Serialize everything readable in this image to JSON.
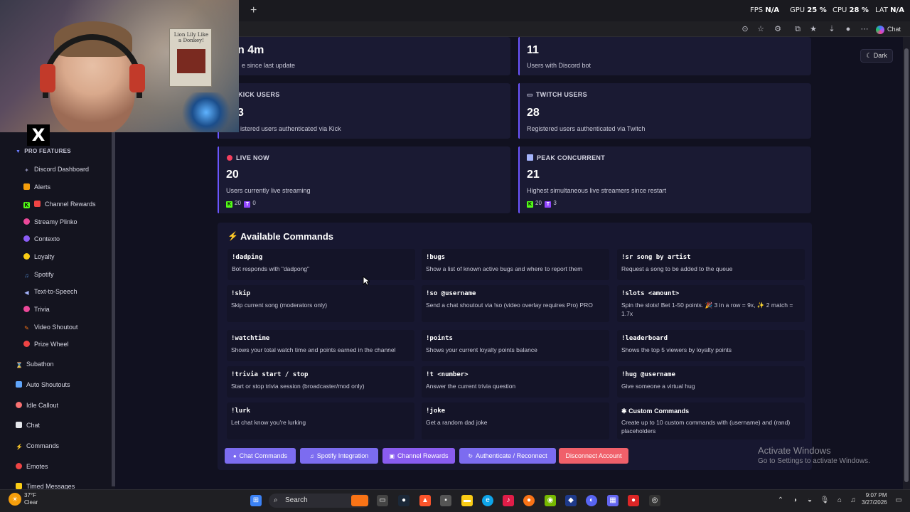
{
  "browser": {
    "new_tab_symbol": "+",
    "chat_label": "Chat",
    "perf": {
      "fps_label": "FPS",
      "fps_value": "N/A",
      "gpu_label": "GPU",
      "gpu_value": "25 %",
      "cpu_label": "CPU",
      "cpu_value": "28 %",
      "lat_label": "LAT",
      "lat_value": "N/A"
    }
  },
  "webcam": {
    "poster_text": "Lion Lily Like a Donkey!"
  },
  "theme_toggle": {
    "label": "Dark",
    "icon": "moon-icon"
  },
  "sidebar": {
    "pro_header": "PRO FEATURES",
    "pro_items": [
      {
        "label": "Discord Dashboard",
        "icon": "discord-icon",
        "color": "#8b8bb0"
      },
      {
        "label": "Alerts",
        "icon": "bell-icon",
        "color": "#f59e0b"
      },
      {
        "label": "Channel Rewards",
        "icon": "gift-icon",
        "color": "#ef4444"
      },
      {
        "label": "Streamy Plinko",
        "icon": "plinko-icon",
        "color": "#ec4899"
      },
      {
        "label": "Contexto",
        "icon": "contexto-icon",
        "color": "#8b5cf6"
      },
      {
        "label": "Loyalty",
        "icon": "heart-icon",
        "color": "#facc15"
      },
      {
        "label": "Spotify",
        "icon": "music-icon",
        "color": "#60a5fa"
      },
      {
        "label": "Text-to-Speech",
        "icon": "speaker-icon",
        "color": "#a5b4fc"
      },
      {
        "label": "Trivia",
        "icon": "trivia-icon",
        "color": "#ec4899"
      },
      {
        "label": "Video Shoutout",
        "icon": "video-icon",
        "color": "#f97316"
      },
      {
        "label": "Prize Wheel",
        "icon": "wheel-icon",
        "color": "#ef4444"
      }
    ],
    "items": [
      {
        "label": "Subathon",
        "icon": "hourglass-icon",
        "color": "#a78bfa"
      },
      {
        "label": "Auto Shoutouts",
        "icon": "shoutout-icon",
        "color": "#60a5fa"
      },
      {
        "label": "Idle Callout",
        "icon": "clock-icon",
        "color": "#f87171"
      },
      {
        "label": "Chat",
        "icon": "chat-icon",
        "color": "#e5e7eb"
      },
      {
        "label": "Commands",
        "icon": "bolt-icon",
        "color": "#f97316"
      },
      {
        "label": "Emotes",
        "icon": "emote-icon",
        "color": "#ef4444"
      },
      {
        "label": "Timed Messages",
        "icon": "timer-icon",
        "color": "#facc15"
      }
    ]
  },
  "stats": [
    {
      "label": "",
      "value": "4m",
      "value_prefix": "n",
      "desc": "e since last update",
      "icon": "clock-icon"
    },
    {
      "label": "",
      "value": "11",
      "desc": "Users with Discord bot",
      "icon": "discord-icon"
    },
    {
      "label": "KICK USERS",
      "value": "3",
      "desc": "istered users authenticated via Kick",
      "icon": "kick-icon"
    },
    {
      "label": "TWITCH USERS",
      "value": "28",
      "desc": "Registered users authenticated via Twitch",
      "icon": "twitch-icon"
    },
    {
      "label": "LIVE NOW",
      "value": "20",
      "desc": "Users currently live streaming",
      "icon": "live-dot-icon",
      "kick_count": "20",
      "twitch_count": "0"
    },
    {
      "label": "PEAK CONCURRENT",
      "value": "21",
      "desc": "Highest simultaneous live streamers since restart",
      "icon": "chart-icon",
      "kick_count": "20",
      "twitch_count": "3"
    }
  ],
  "commands": {
    "title": "Available Commands",
    "items": [
      {
        "name": "!dadping",
        "desc": "Bot responds with \"dadpong\""
      },
      {
        "name": "!bugs",
        "desc": "Show a list of known active bugs and where to report them"
      },
      {
        "name": "!sr song by artist",
        "desc": "Request a song to be added to the queue"
      },
      {
        "name": "!skip",
        "desc": "Skip current song (moderators only)"
      },
      {
        "name": "!so @username",
        "desc": "Send a chat shoutout via !so (video overlay requires Pro) PRO"
      },
      {
        "name": "!slots <amount>",
        "desc": "Spin the slots! Bet 1-50 points. 🎉 3 in a row = 9x, ✨ 2 match = 1.7x"
      },
      {
        "name": "!watchtime",
        "desc": "Shows your total watch time and points earned in the channel"
      },
      {
        "name": "!points",
        "desc": "Shows your current loyalty points balance"
      },
      {
        "name": "!leaderboard",
        "desc": "Shows the top 5 viewers by loyalty points"
      },
      {
        "name": "!trivia start / stop",
        "desc": "Start or stop trivia session (broadcaster/mod only)"
      },
      {
        "name": "!t <number>",
        "desc": "Answer the current trivia question"
      },
      {
        "name": "!hug @username",
        "desc": "Give someone a virtual hug"
      },
      {
        "name": "!lurk",
        "desc": "Let chat know you're lurking"
      },
      {
        "name": "!joke",
        "desc": "Get a random dad joke"
      },
      {
        "name": "Custom Commands",
        "desc": "Create up to 10 custom commands with (username) and (rand) placeholders"
      }
    ]
  },
  "buttons": [
    {
      "label": "Chat Commands",
      "color": "#7c6cf0",
      "icon": "chat-icon"
    },
    {
      "label": "Spotify Integration",
      "color": "#7c6cf0",
      "icon": "music-icon"
    },
    {
      "label": "Channel Rewards",
      "color": "#8a5cf0",
      "icon": "gift-icon"
    },
    {
      "label": "Authenticate / Reconnect",
      "color": "#7c6cf0",
      "icon": "refresh-icon"
    },
    {
      "label": "Disconnect Account",
      "color": "#f0606a",
      "icon": "disconnect-icon"
    }
  ],
  "watermark": {
    "title": "Activate Windows",
    "subtitle": "Go to Settings to activate Windows."
  },
  "taskbar": {
    "search_placeholder": "Search",
    "weather_temp": "37°F",
    "weather_desc": "Clear",
    "time": "9:07 PM",
    "date": "3/27/2026"
  }
}
